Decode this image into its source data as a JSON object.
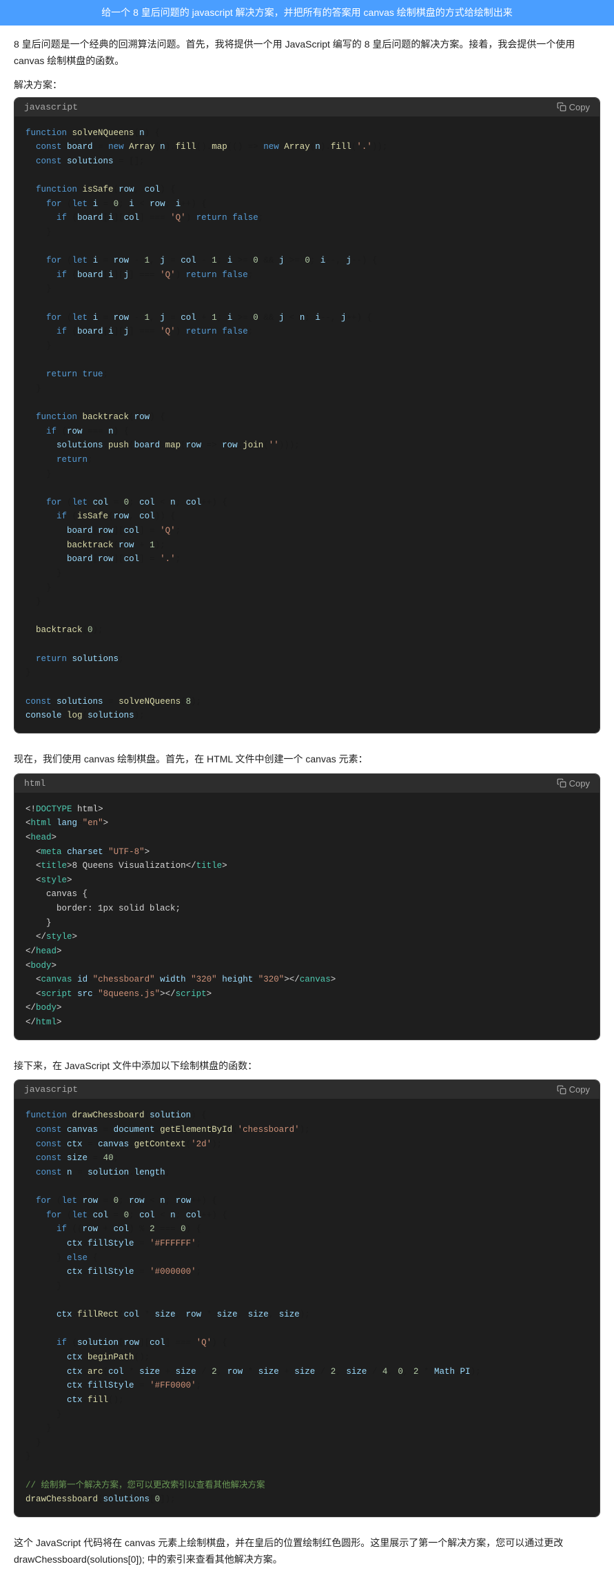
{
  "prompt": {
    "text": "给一个 8 皇后问题的 javascript 解决方案，并把所有的答案用 canvas 绘制棋盘的方式给绘制出来"
  },
  "intro": {
    "text": "8 皇后问题是一个经典的回溯算法问题。首先，我将提供一个用 JavaScript 编写的 8 皇后问题的解决方案。接着，我会提供一个使用 canvas 绘制棋盘的函数。"
  },
  "solution_label": {
    "text": "解决方案："
  },
  "block1": {
    "lang": "javascript",
    "copy": "Copy"
  },
  "inter1": {
    "text": "现在，我们使用 canvas 绘制棋盘。首先，在 HTML 文件中创建一个 canvas 元素："
  },
  "block2": {
    "lang": "html",
    "copy": "Copy"
  },
  "inter2": {
    "text": "接下来，在 JavaScript 文件中添加以下绘制棋盘的函数："
  },
  "block3": {
    "lang": "javascript",
    "copy": "Copy"
  },
  "footer": {
    "text": "这个 JavaScript 代码将在 canvas 元素上绘制棋盘，并在皇后的位置绘制红色圆形。这里展示了第一个解决方案，您可以通过更改 drawChessboard(solutions[0]); 中的索引来查看其他解决方案。"
  }
}
